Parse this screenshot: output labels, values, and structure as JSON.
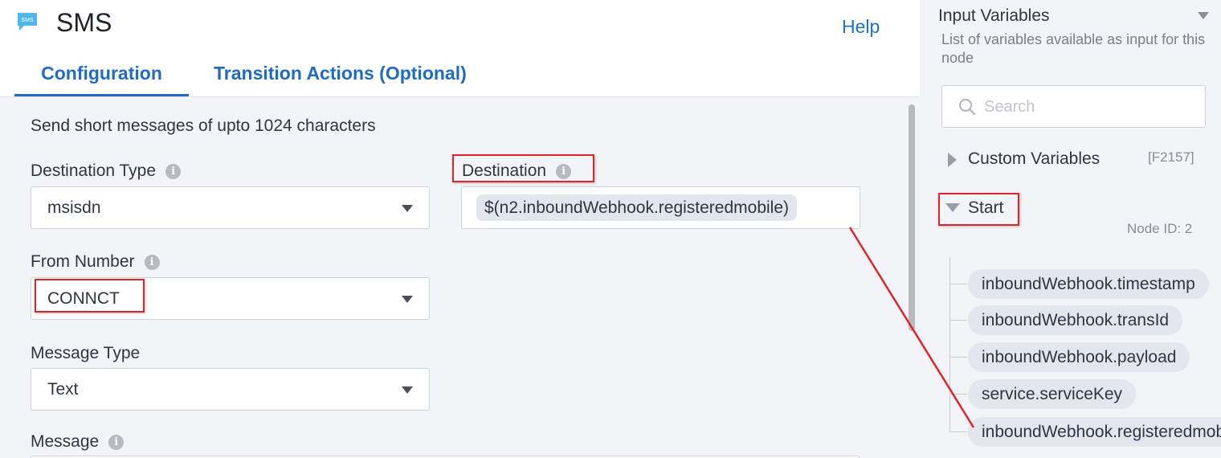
{
  "header": {
    "title": "SMS",
    "icon_text": "SMS",
    "help_label": "Help",
    "tabs": [
      {
        "label": "Configuration",
        "active": true
      },
      {
        "label": "Transition Actions (Optional)",
        "active": false
      }
    ]
  },
  "form": {
    "description": "Send short messages of upto 1024 characters",
    "destination_type": {
      "label": "Destination Type",
      "value": "msisdn"
    },
    "destination": {
      "label": "Destination",
      "value": "$(n2.inboundWebhook.registeredmobile)"
    },
    "from_number": {
      "label": "From Number",
      "value": "CONNCT"
    },
    "message_type": {
      "label": "Message Type",
      "value": "Text"
    },
    "message": {
      "label": "Message"
    }
  },
  "input_variables": {
    "title": "Input Variables",
    "subtitle": "List of variables available as input for this node",
    "search_placeholder": "Search",
    "custom_label": "Custom Variables",
    "custom_code": "[F2157]",
    "start_label": "Start",
    "node_id": "Node ID: 2",
    "variables": [
      "inboundWebhook.timestamp",
      "inboundWebhook.transId",
      "inboundWebhook.payload",
      "service.serviceKey",
      "inboundWebhook.registeredmobile"
    ]
  },
  "colors": {
    "accent": "#1f6bc4",
    "highlight_red": "#e0242a",
    "panel_bg": "#f3f4f7"
  }
}
